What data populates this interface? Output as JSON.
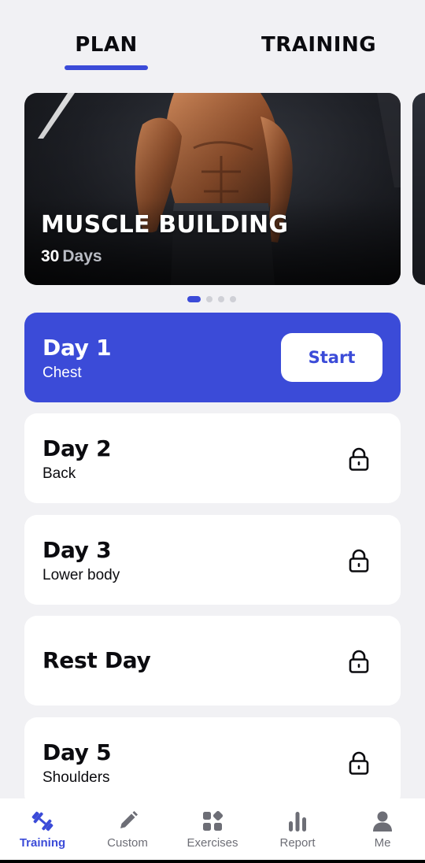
{
  "header": {
    "tabs": [
      {
        "label": "PLAN",
        "active": true
      },
      {
        "label": "TRAINING",
        "active": false
      }
    ]
  },
  "banner": {
    "title": "MUSCLE BUILDING",
    "days_number": "30",
    "days_unit": "Days",
    "pager": {
      "count": 4,
      "active_index": 0
    }
  },
  "plan": {
    "days": [
      {
        "title": "Day 1",
        "subtitle": "Chest",
        "state": "current",
        "button": "Start"
      },
      {
        "title": "Day 2",
        "subtitle": "Back",
        "state": "locked",
        "icon": "lock-icon"
      },
      {
        "title": "Day 3",
        "subtitle": "Lower body",
        "state": "locked",
        "icon": "lock-icon"
      },
      {
        "title": "Rest Day",
        "subtitle": "",
        "state": "locked",
        "icon": "lock-icon"
      },
      {
        "title": "Day 5",
        "subtitle": "Shoulders",
        "state": "locked",
        "icon": "lock-icon"
      }
    ]
  },
  "bottom_nav": {
    "items": [
      {
        "label": "Training",
        "icon": "dumbbell-icon",
        "active": true
      },
      {
        "label": "Custom",
        "icon": "pencil-icon",
        "active": false
      },
      {
        "label": "Exercises",
        "icon": "grid-icon",
        "active": false
      },
      {
        "label": "Report",
        "icon": "bar-chart-icon",
        "active": false
      },
      {
        "label": "Me",
        "icon": "person-icon",
        "active": false
      }
    ]
  },
  "colors": {
    "accent": "#3b4bd8",
    "background": "#f1f1f4",
    "card": "#ffffff",
    "inactive_text": "#6d6e76"
  }
}
